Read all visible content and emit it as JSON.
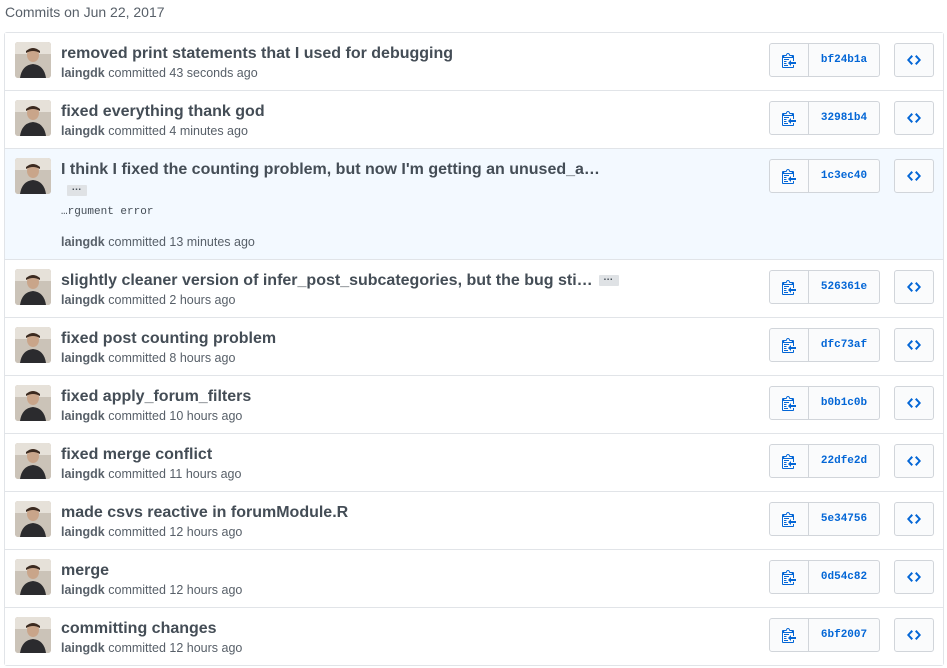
{
  "heading": "Commits on Jun 22, 2017",
  "icons": {
    "avatar": "avatar-icon",
    "copy": "clippy-icon",
    "browse": "code-icon",
    "accent": "#0366d6"
  },
  "commits": [
    {
      "title": "removed print statements that I used for debugging",
      "author": "laingdk",
      "verb": "committed",
      "time": "43 seconds ago",
      "sha": "bf24b1a"
    },
    {
      "title": "fixed everything thank god",
      "author": "laingdk",
      "verb": "committed",
      "time": "4 minutes ago",
      "sha": "32981b4"
    },
    {
      "title": "I think I fixed the counting problem, but now I'm getting an unused_a…",
      "ellipsis": "…",
      "body": "…rgument error",
      "author": "laingdk",
      "verb": "committed",
      "time": "13 minutes ago",
      "sha": "1c3ec40"
    },
    {
      "title": "slightly cleaner version of infer_post_subcategories, but the bug sti…",
      "ellipsis": "…",
      "author": "laingdk",
      "verb": "committed",
      "time": "2 hours ago",
      "sha": "526361e"
    },
    {
      "title": "fixed post counting problem",
      "author": "laingdk",
      "verb": "committed",
      "time": "8 hours ago",
      "sha": "dfc73af"
    },
    {
      "title": "fixed apply_forum_filters",
      "author": "laingdk",
      "verb": "committed",
      "time": "10 hours ago",
      "sha": "b0b1c0b"
    },
    {
      "title": "fixed merge conflict",
      "author": "laingdk",
      "verb": "committed",
      "time": "11 hours ago",
      "sha": "22dfe2d"
    },
    {
      "title": "made csvs reactive in forumModule.R",
      "author": "laingdk",
      "verb": "committed",
      "time": "12 hours ago",
      "sha": "5e34756"
    },
    {
      "title": "merge",
      "author": "laingdk",
      "verb": "committed",
      "time": "12 hours ago",
      "sha": "0d54c82"
    },
    {
      "title": "committing changes",
      "author": "laingdk",
      "verb": "committed",
      "time": "12 hours ago",
      "sha": "6bf2007"
    }
  ]
}
